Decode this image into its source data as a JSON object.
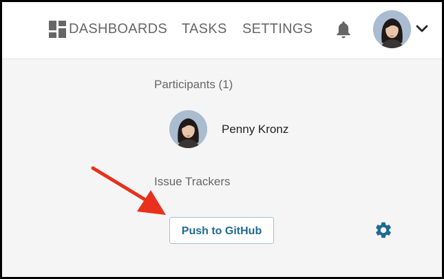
{
  "header": {
    "nav": {
      "dashboards": "DASHBOARDS",
      "tasks": "TASKS",
      "settings": "SETTINGS"
    },
    "icons": {
      "dashboards": "dashboard-grid-icon",
      "notifications": "bell-icon",
      "account_menu": "chevron-down-icon"
    }
  },
  "participants": {
    "title": "Participants (1)",
    "list": [
      {
        "name": "Penny Kronz"
      }
    ]
  },
  "issue_trackers": {
    "title": "Issue Trackers",
    "button_label": "Push to GitHub",
    "settings_icon": "gear-icon"
  },
  "colors": {
    "accent": "#1e6a92",
    "annotation_arrow": "#e8301c",
    "icon_gray": "#666666"
  }
}
